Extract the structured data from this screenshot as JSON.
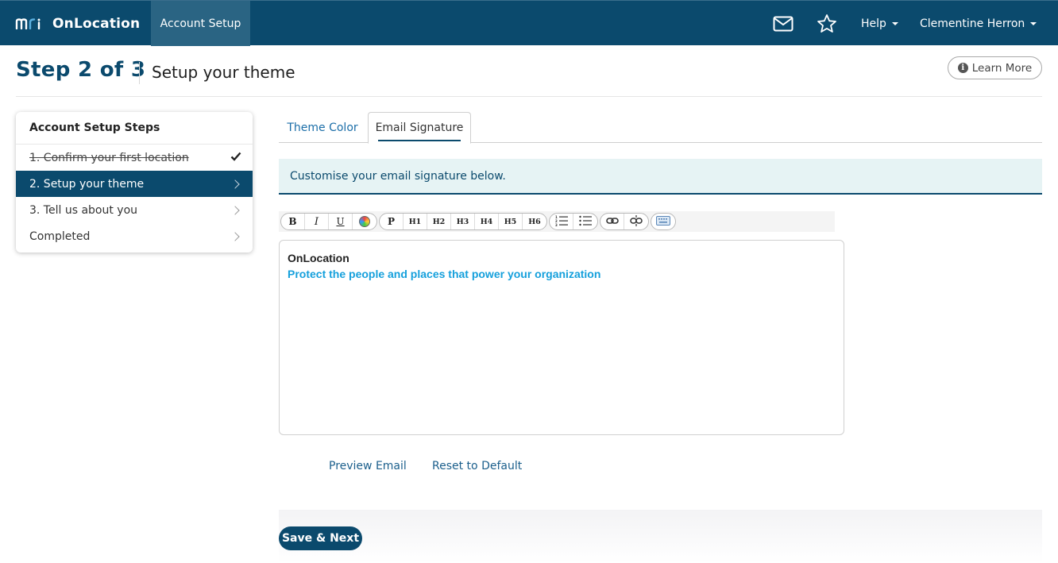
{
  "topnav": {
    "brand_name": "OnLocation",
    "active_tab": "Account Setup",
    "icons": [
      "mail-icon",
      "star-icon"
    ],
    "help_label": "Help",
    "user_name": "Clementine Herron"
  },
  "header": {
    "step_title": "Step 2 of 3",
    "subtitle": "Setup your theme",
    "learn_more": "Learn More"
  },
  "steps": {
    "title": "Account Setup Steps",
    "items": [
      {
        "label": "1. Confirm your first location",
        "state": "done"
      },
      {
        "label": "2. Setup your theme",
        "state": "active"
      },
      {
        "label": "3. Tell us about you",
        "state": "pending"
      },
      {
        "label": "Completed",
        "state": "pending"
      }
    ]
  },
  "tabs": {
    "theme_color": "Theme Color",
    "email_signature": "Email Signature"
  },
  "banner": {
    "text": "Customise your email signature below."
  },
  "toolbar": {
    "bold": "B",
    "italic": "I",
    "underline": "U",
    "paragraph": "P",
    "h1": "H1",
    "h2": "H2",
    "h3": "H3",
    "h4": "H4",
    "h5": "H5",
    "h6": "H6"
  },
  "editor": {
    "signature_name": "OnLocation",
    "signature_tagline": "Protect the people and places that power your organization"
  },
  "actions": {
    "preview_email": "Preview Email",
    "reset_default": "Reset to Default",
    "save_next": "Save & Next"
  },
  "colors": {
    "primary": "#0b4a6d",
    "link": "#1b6ea8",
    "tagline": "#15a0dc",
    "banner_bg": "#e6f3f4"
  }
}
